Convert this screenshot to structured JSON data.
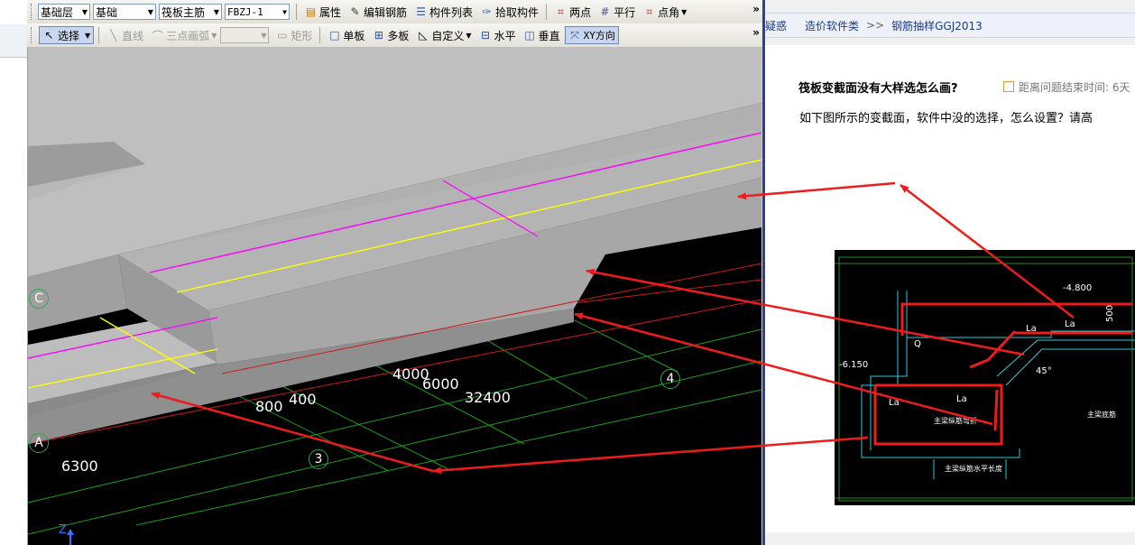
{
  "toolbar1": {
    "floor": "基础层",
    "category": "基础",
    "type": "筏板主筋",
    "member": "FBZJ-1",
    "buttons": [
      "属性",
      "编辑钢筋",
      "构件列表",
      "拾取构件",
      "两点",
      "平行",
      "点角"
    ]
  },
  "toolbar2": {
    "select": "选择",
    "buttons": [
      "直线",
      "三点画弧",
      "矩形",
      "单板",
      "多板",
      "自定义",
      "水平",
      "垂直",
      "XY方向"
    ]
  },
  "viewport": {
    "labels": [
      "800",
      "400",
      "4000",
      "6000",
      "32400",
      "6300"
    ],
    "axes": [
      "C",
      "A",
      "3",
      "4"
    ],
    "z_axis": "Z",
    "colors": {
      "slab": "#b3b3b3",
      "rebar_top": "#ff00ff",
      "rebar_mid": "#ffff00",
      "grid": "#1aa01a",
      "axis_red": "#d01818"
    }
  },
  "web": {
    "breadcrumb": [
      "疑惑",
      "造价软件类",
      ">>",
      "钢筋抽样GGJ2013"
    ],
    "question_title": "筏板变截面没有大样选怎么画?",
    "time_label": "距离问题结束时间: 6天",
    "question_body": "如下图所示的变截面，软件中没的选择，怎么设置？请高",
    "drawing_labels": [
      "-4.800",
      "-6.150",
      "La",
      "La",
      "La",
      "La",
      "Q",
      "500",
      "45°",
      "主梁纵筋弯折",
      "主梁纵筋水平长度",
      "主梁底筋"
    ]
  },
  "annotation_color": "#ee1c1c"
}
